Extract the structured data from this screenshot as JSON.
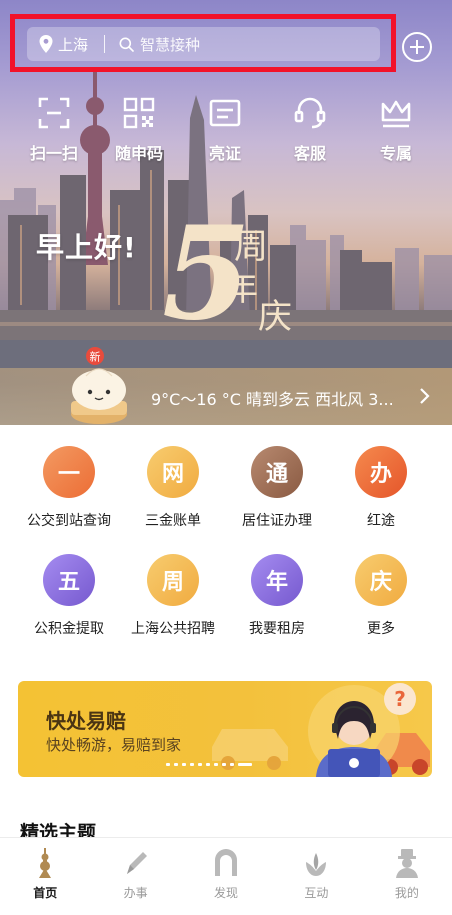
{
  "header": {
    "city": "上海",
    "search_placeholder": "智慧接种"
  },
  "quick_actions": [
    {
      "label": "扫一扫",
      "icon": "scan-icon"
    },
    {
      "label": "随申码",
      "icon": "qr-code-icon"
    },
    {
      "label": "亮证",
      "icon": "card-icon"
    },
    {
      "label": "客服",
      "icon": "customer-service-icon"
    },
    {
      "label": "专属",
      "icon": "crown-icon"
    }
  ],
  "hero": {
    "greeting": "早上好!",
    "anniversary_badge": {
      "number": "5",
      "char1": "周",
      "char2": "年",
      "char3": "庆"
    },
    "bun_badge": "新",
    "weather": "9°C～16 °C 晴到多云 西北风 3..."
  },
  "services": [
    {
      "char": "一",
      "label": "公交到站查询",
      "color": "#ef7a45"
    },
    {
      "char": "网",
      "label": "三金账单",
      "color": "#f3b64e"
    },
    {
      "char": "通",
      "label": "居住证办理",
      "color": "#9a6a52"
    },
    {
      "char": "办",
      "label": "红途",
      "color": "#ec6a36"
    },
    {
      "char": "五",
      "label": "公积金提取",
      "color": "#8a6fd9"
    },
    {
      "char": "周",
      "label": "上海公共招聘",
      "color": "#f3b64e"
    },
    {
      "char": "年",
      "label": "我要租房",
      "color": "#8a6fd9"
    },
    {
      "char": "庆",
      "label": "更多",
      "color": "#f3b64e"
    }
  ],
  "banner": {
    "title": "快处易赔",
    "subtitle": "快处畅游，易赔到家",
    "badge": "?",
    "dot_count": 10,
    "active_dot": 9
  },
  "section_title": "精选主题",
  "tabs": [
    {
      "label": "首页",
      "icon": "home-tower-icon",
      "active": true
    },
    {
      "label": "办事",
      "icon": "pen-icon",
      "active": false
    },
    {
      "label": "发现",
      "icon": "arch-icon",
      "active": false
    },
    {
      "label": "互动",
      "icon": "flower-icon",
      "active": false
    },
    {
      "label": "我的",
      "icon": "profile-icon",
      "active": false
    }
  ],
  "colors": {
    "highlight_border": "#f2122a",
    "banner_bg": "#f4c234",
    "tab_active": "#1a1a1a",
    "tab_inactive": "#9a9a9a"
  }
}
